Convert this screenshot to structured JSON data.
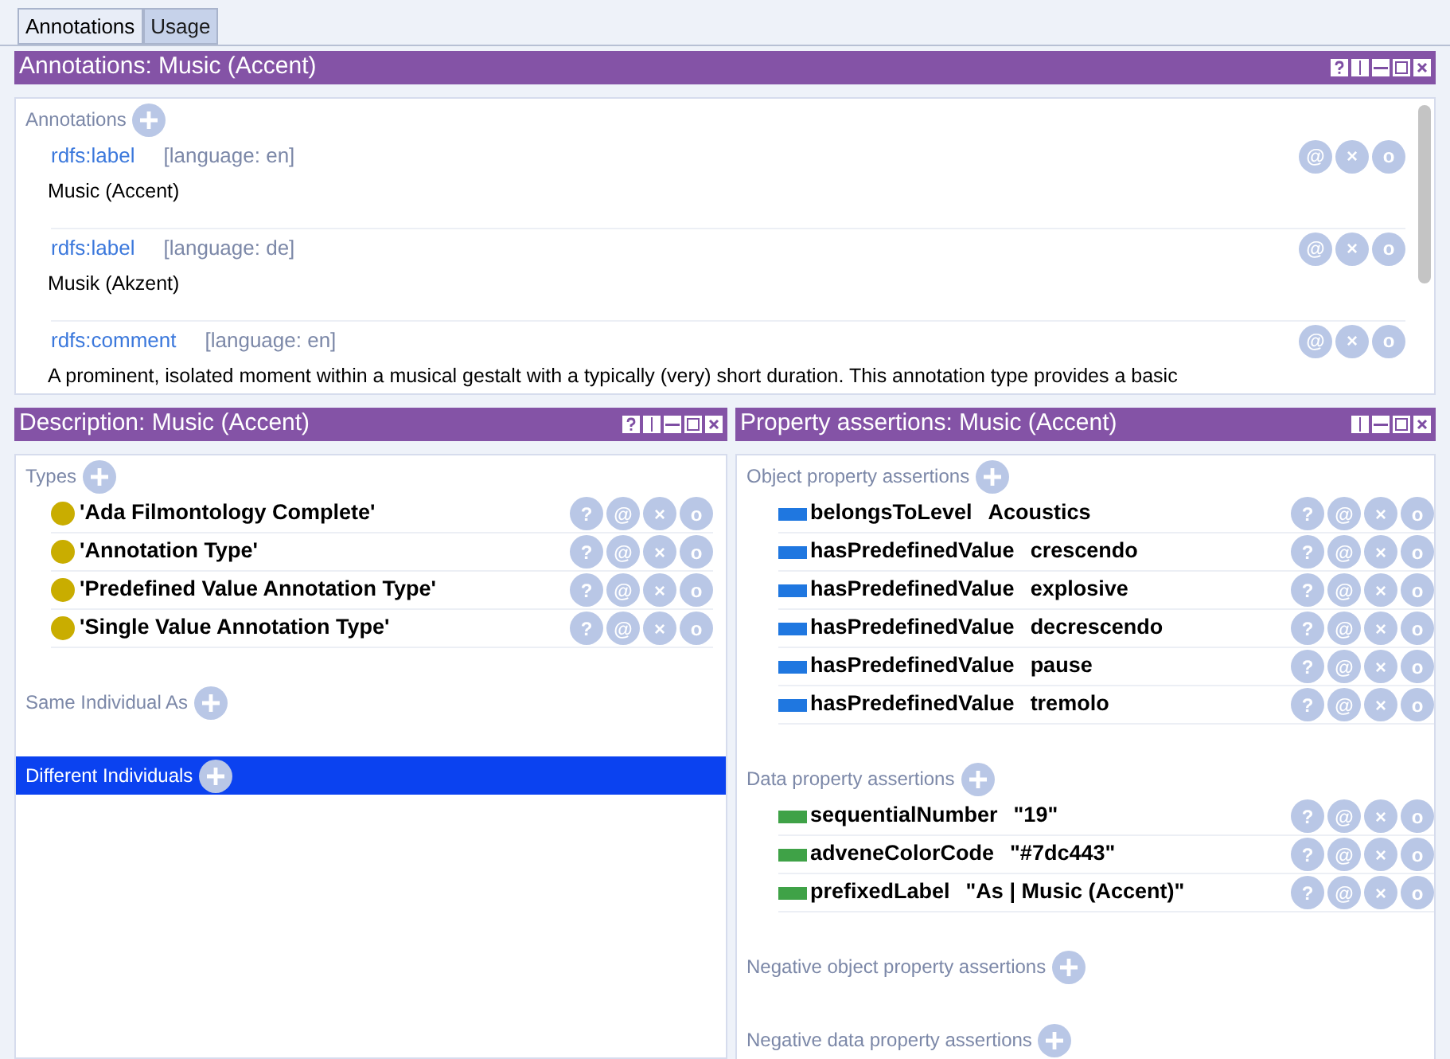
{
  "tabs": [
    {
      "label": "Annotations",
      "selected": true
    },
    {
      "label": "Usage",
      "selected": false
    }
  ],
  "annotations_panel": {
    "title": "Annotations: Music (Accent)",
    "controls": [
      {
        "kind": "help"
      },
      {
        "kind": "split"
      },
      {
        "kind": "minimize"
      },
      {
        "kind": "maximize"
      },
      {
        "kind": "close"
      }
    ],
    "section": "Annotations",
    "items": [
      {
        "property": "rdfs:label",
        "language": "[language: en]",
        "value": "Music (Accent)",
        "actions": [
          "@",
          "×",
          "o"
        ]
      },
      {
        "property": "rdfs:label",
        "language": "[language: de]",
        "value": "Musik (Akzent)",
        "actions": [
          "@",
          "×",
          "o"
        ]
      },
      {
        "property": "rdfs:comment",
        "language": "[language: en]",
        "value": "A prominent, isolated moment within a musical gestalt with a typically (very) short duration. This annotation type provides a basic",
        "actions": [
          "@",
          "×",
          "o"
        ]
      }
    ]
  },
  "description_panel": {
    "title": "Description: Music (Accent)",
    "controls": [
      {
        "kind": "help"
      },
      {
        "kind": "split"
      },
      {
        "kind": "minimize"
      },
      {
        "kind": "maximize"
      },
      {
        "kind": "close"
      }
    ],
    "sections": [
      {
        "label": "Types",
        "selected": false,
        "items": [
          {
            "text": "'Ada Filmontology Complete'",
            "color": "#c9ad00",
            "actions": [
              "?",
              "@",
              "×",
              "o"
            ]
          },
          {
            "text": "'Annotation Type'",
            "color": "#c9ad00",
            "actions": [
              "?",
              "@",
              "×",
              "o"
            ]
          },
          {
            "text": "'Predefined Value Annotation Type'",
            "color": "#c9ad00",
            "actions": [
              "?",
              "@",
              "×",
              "o"
            ]
          },
          {
            "text": "'Single Value Annotation Type'",
            "color": "#c9ad00",
            "actions": [
              "?",
              "@",
              "×",
              "o"
            ]
          }
        ]
      },
      {
        "label": "Same Individual As",
        "selected": false
      },
      {
        "label": "Different Individuals",
        "selected": true
      }
    ]
  },
  "property_panel": {
    "title": "Property assertions: Music (Accent)",
    "controls": [
      {
        "kind": "split"
      },
      {
        "kind": "minimize"
      },
      {
        "kind": "maximize"
      },
      {
        "kind": "close"
      }
    ],
    "sections": [
      {
        "label": "Object property assertions",
        "selected": false,
        "items": [
          {
            "property": "belongsToLevel",
            "value": "Acoustics",
            "color": "#1f77e0",
            "actions": [
              "?",
              "@",
              "×",
              "o"
            ]
          },
          {
            "property": "hasPredefinedValue",
            "value": "crescendo",
            "color": "#1f77e0",
            "actions": [
              "?",
              "@",
              "×",
              "o"
            ]
          },
          {
            "property": "hasPredefinedValue",
            "value": "explosive",
            "color": "#1f77e0",
            "actions": [
              "?",
              "@",
              "×",
              "o"
            ]
          },
          {
            "property": "hasPredefinedValue",
            "value": "decrescendo",
            "color": "#1f77e0",
            "actions": [
              "?",
              "@",
              "×",
              "o"
            ]
          },
          {
            "property": "hasPredefinedValue",
            "value": "pause",
            "color": "#1f77e0",
            "actions": [
              "?",
              "@",
              "×",
              "o"
            ]
          },
          {
            "property": "hasPredefinedValue",
            "value": "tremolo",
            "color": "#1f77e0",
            "actions": [
              "?",
              "@",
              "×",
              "o"
            ]
          }
        ]
      },
      {
        "label": "Data property assertions",
        "selected": false,
        "items": [
          {
            "property": "sequentialNumber",
            "value": "\"19\"",
            "color": "#3fa247",
            "actions": [
              "?",
              "@",
              "×",
              "o"
            ]
          },
          {
            "property": "adveneColorCode",
            "value": "\"#7dc443\"",
            "color": "#3fa247",
            "actions": [
              "?",
              "@",
              "×",
              "o"
            ]
          },
          {
            "property": "prefixedLabel",
            "value": "\"As | Music (Accent)\"",
            "color": "#3fa247",
            "actions": [
              "?",
              "@",
              "×",
              "o"
            ]
          }
        ]
      },
      {
        "label": "Negative object property assertions",
        "selected": false
      },
      {
        "label": "Negative data property assertions",
        "selected": false
      }
    ]
  }
}
